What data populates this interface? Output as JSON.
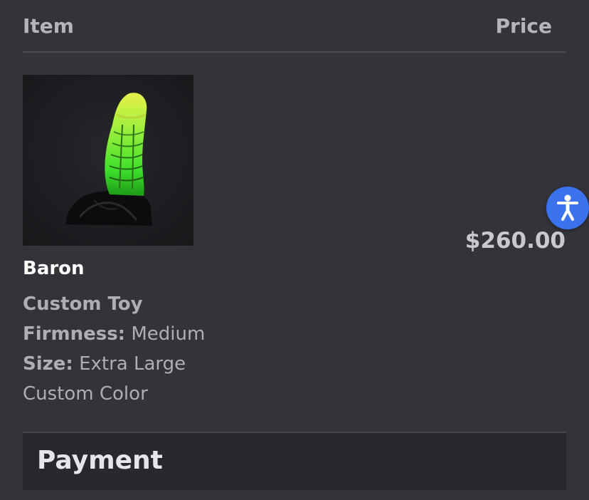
{
  "table": {
    "col_item": "Item",
    "col_price": "Price"
  },
  "product": {
    "name": "Baron",
    "line1": "Custom Toy",
    "firmness_label": "Firmness:",
    "firmness_value": "Medium",
    "size_label": "Size:",
    "size_value": "Extra Large",
    "line4": "Custom Color",
    "price": "$260.00"
  },
  "payment": {
    "heading": "Payment"
  },
  "colors": {
    "background": "#33343a",
    "accessibility_button": "#3b72ee"
  },
  "icons": {
    "accessibility": "accessibility-person-icon"
  }
}
